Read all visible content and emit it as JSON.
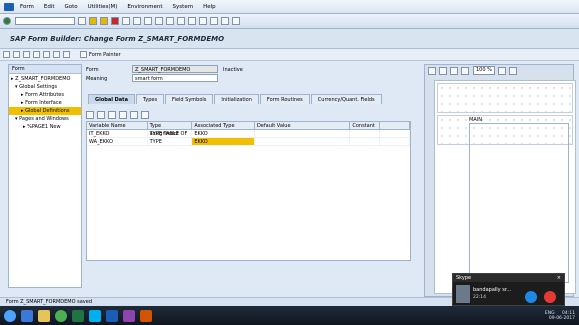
{
  "menu": {
    "items": [
      "Form",
      "Edit",
      "Goto",
      "Utilities(M)",
      "Environment",
      "System",
      "Help"
    ]
  },
  "title": "SAP Form Builder: Change Form Z_SMART_FORMDEMO",
  "app_toolbar": {
    "form_painter_label": "Form Painter"
  },
  "nav": {
    "header": "Form",
    "tree": [
      "Z_SMART_FORMDEMO",
      "Global Settings",
      "Form Attributes",
      "Form Interface",
      "Global Definitions",
      "Pages and Windows",
      "%PAGE1 New"
    ]
  },
  "form_header": {
    "form_label": "Form",
    "form_value": "Z_SMART_FORMDEMO",
    "status": "Inactive",
    "meaning_label": "Meaning",
    "meaning_value": "smart form"
  },
  "tabs": [
    "Global Data",
    "Types",
    "Field Symbols",
    "Initialization",
    "Form Routines",
    "Currency/Quant. Fields"
  ],
  "grid": {
    "headers": [
      "Variable Name",
      "Type assignment",
      "Associated Type",
      "Default Value",
      "Constant"
    ],
    "rows": [
      {
        "var": "IT_EKKO",
        "type": "TYPE TABLE OF",
        "assoc": "EKKO",
        "default": ""
      },
      {
        "var": "WA_EKKO",
        "type": "TYPE",
        "assoc": "EKKO",
        "default": ""
      }
    ]
  },
  "painter": {
    "zoom": "100 %",
    "window_label": "MAIN"
  },
  "status": {
    "message": "Form Z_SMART_FORMDEMO saved"
  },
  "skype": {
    "app_name": "Skype",
    "caller": "bandapally sr...",
    "duration": "22:14"
  },
  "tray": {
    "lang": "ENG",
    "time": "04:11",
    "date": "09-06-2017"
  },
  "colors": {
    "selection": "#f0c000",
    "call_accept": "#1e88e5",
    "call_reject": "#e53935"
  }
}
